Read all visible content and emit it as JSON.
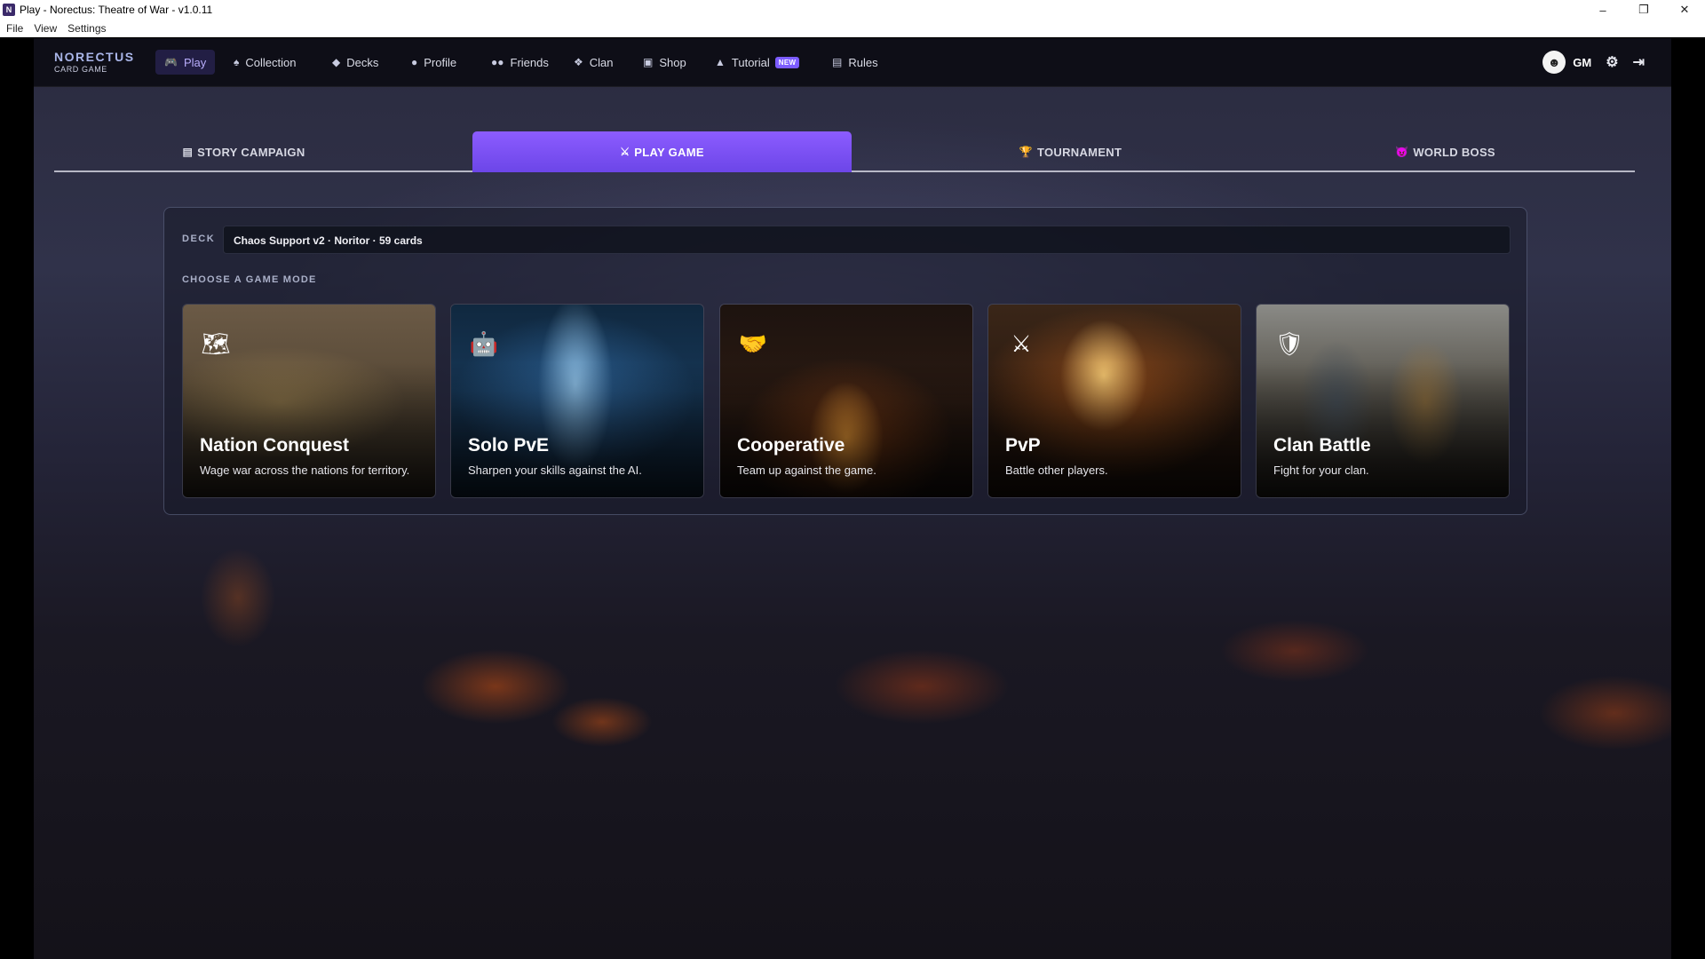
{
  "window": {
    "title": "Play - Norectus: Theatre of War - v1.0.11",
    "app_icon_letter": "N",
    "controls": {
      "minimize": "–",
      "maximize": "❐",
      "close": "✕"
    }
  },
  "menubar": {
    "items": [
      "File",
      "View",
      "Settings"
    ]
  },
  "brand": {
    "name": "NORECTUS",
    "sub": "CARD GAME"
  },
  "nav": {
    "items": [
      {
        "label": "Play",
        "icon": "gamepad-icon",
        "glyph": "🎮"
      },
      {
        "label": "Collection",
        "icon": "cards-icon",
        "glyph": "♠"
      },
      {
        "label": "Decks",
        "icon": "layers-icon",
        "glyph": "◆"
      },
      {
        "label": "Profile",
        "icon": "user-icon",
        "glyph": "●"
      },
      {
        "label": "Friends",
        "icon": "friends-icon",
        "glyph": "●●"
      },
      {
        "label": "Clan",
        "icon": "group-icon",
        "glyph": "❖"
      },
      {
        "label": "Shop",
        "icon": "store-icon",
        "glyph": "▣"
      },
      {
        "label": "Tutorial",
        "icon": "graduation-cap-icon",
        "glyph": "▲",
        "badge": "NEW"
      },
      {
        "label": "Rules",
        "icon": "book-icon",
        "glyph": "▤"
      }
    ],
    "active": "Play"
  },
  "user": {
    "initials": "GM",
    "avatar_glyph": "☻"
  },
  "mode_tabs": [
    {
      "label": "STORY CAMPAIGN",
      "glyph": "▤"
    },
    {
      "label": "PLAY GAME",
      "glyph": "⚔"
    },
    {
      "label": "TOURNAMENT",
      "glyph": "🏆"
    },
    {
      "label": "WORLD BOSS",
      "glyph": "😈"
    }
  ],
  "active_mode_tab": "PLAY GAME",
  "deck": {
    "label": "DECK",
    "selected": "Chaos Support v2 · Noritor · 59 cards"
  },
  "choose_label": "CHOOSE A GAME MODE",
  "modes": [
    {
      "title": "Nation Conquest",
      "desc": "Wage war across the nations for territory.",
      "icon": "map-icon",
      "glyph": "🗺"
    },
    {
      "title": "Solo PvE",
      "desc": "Sharpen your skills against the AI.",
      "icon": "robot-icon",
      "glyph": "🤖"
    },
    {
      "title": "Cooperative",
      "desc": "Team up against the game.",
      "icon": "handshake-icon",
      "glyph": "🤝"
    },
    {
      "title": "PvP",
      "desc": "Battle other players.",
      "icon": "crossed-swords-icon",
      "glyph": "⚔"
    },
    {
      "title": "Clan Battle",
      "desc": "Fight for your clan.",
      "icon": "shield-icon",
      "glyph": "🛡"
    }
  ],
  "colors": {
    "accent": "#7c5cff",
    "active_tab": "#8c5cff",
    "brand": "#a9b5e8"
  }
}
